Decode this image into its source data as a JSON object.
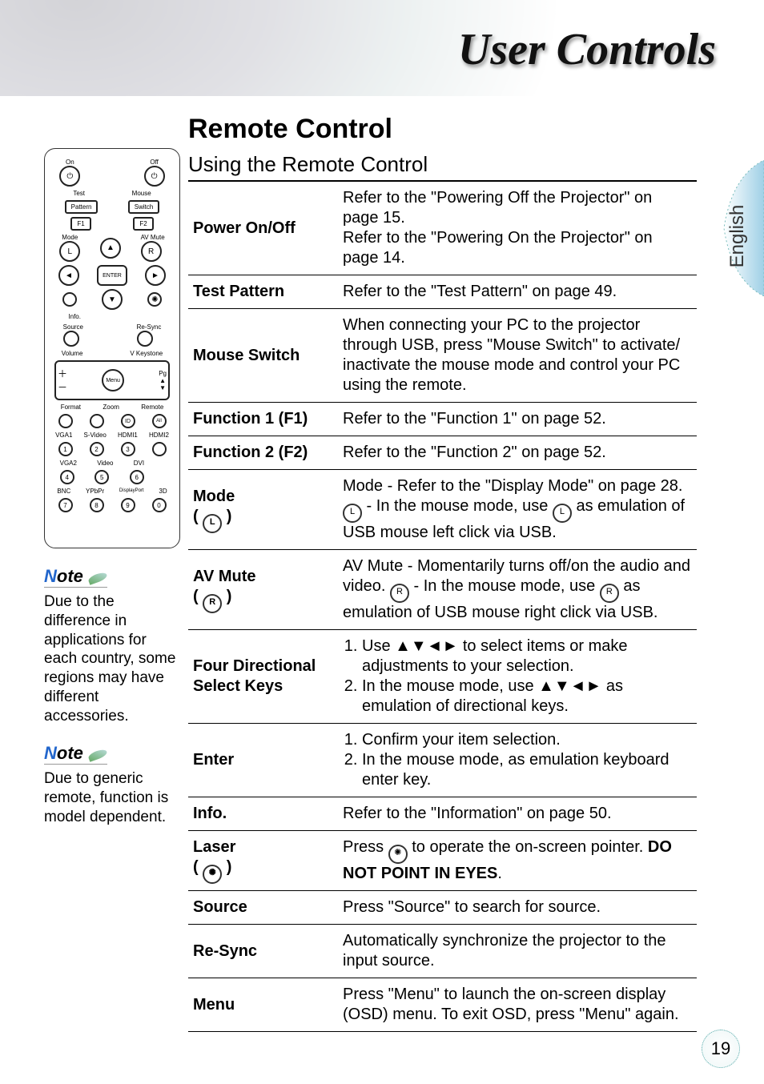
{
  "chapter_title": "User Controls",
  "section_title": "Remote Control",
  "language_tab": "English",
  "page_number": "19",
  "sidebar": {
    "note_label": "ote",
    "note1": "Due to the difference in applications for each country, some regions may have different accessories.",
    "note2": "Due to generic remote,  function is model dependent.",
    "remote_labels": {
      "on": "On",
      "off": "Off",
      "test": "Test",
      "mouse": "Mouse",
      "pattern": "Pattern",
      "switch": "Switch",
      "f1": "F1",
      "f2": "F2",
      "mode": "Mode",
      "avmute": "AV Mute",
      "enter": "ENTER",
      "info": "Info.",
      "resync": "Re-Sync",
      "source": "Source",
      "volume": "Volume",
      "vkey": "V Keystone",
      "menu": "Menu",
      "pg": "Pg",
      "format": "Format",
      "zoom": "Zoom",
      "remote": "Remote",
      "vga1": "VGA1",
      "svideo": "S-Video",
      "hdmi1": "HDMI1",
      "hdmi2": "HDMI2",
      "vga2": "VGA2",
      "video": "Video",
      "dvi": "DVI",
      "bnc": "BNC",
      "ypbpr": "YPbPr",
      "dp": "DisplayPort",
      "threeD": "3D"
    }
  },
  "table": {
    "heading": "Using the Remote Control",
    "rows": [
      {
        "key": "Power On/Off",
        "type": "text",
        "text": "Refer to the \"Powering Off the Projector\" on page 15.\nRefer to the \"Powering On the Projector\" on page 14."
      },
      {
        "key": "Test Pattern",
        "type": "text",
        "text": "Refer to the \"Test Pattern\" on page 49."
      },
      {
        "key": "Mouse Switch",
        "type": "text",
        "text": "When connecting your PC to the projector through USB, press \"Mouse Switch\" to activate/ inactivate the mouse mode and control your PC using the remote."
      },
      {
        "key": "Function 1 (F1)",
        "type": "text",
        "text": "Refer to the \"Function 1\" on page 52."
      },
      {
        "key": "Function 2 (F2)",
        "type": "text",
        "text": "Refer to the \"Function 2\" on page 52."
      },
      {
        "key": "Mode",
        "key_icon": "L",
        "type": "mode",
        "parts": {
          "a": "Mode - Refer to the \"Display Mode\" on page 28.  ",
          "b": " - In the mouse mode, use ",
          "c": " as emulation of USB mouse left click via USB."
        }
      },
      {
        "key": "AV Mute",
        "key_icon": "R",
        "type": "avmute",
        "parts": {
          "a": "AV Mute - Momentarily turns off/on the audio and video.  ",
          "b": " - In the mouse mode, use ",
          "c": " as emulation of USB mouse right click via USB."
        }
      },
      {
        "key": "Four Directional Select Keys",
        "type": "fourdir",
        "parts": {
          "a": "Use ",
          "b": " to select items or make adjustments to your selection.",
          "c": "In the mouse mode, use ",
          "d": " as emulation of directional keys."
        }
      },
      {
        "key": "Enter",
        "type": "enter",
        "parts": {
          "a": "Confirm your item selection.",
          "b": "In the mouse mode, as emulation keyboard enter key."
        }
      },
      {
        "key": "Info.",
        "type": "text",
        "text": "Refer to the \"Information\" on page 50."
      },
      {
        "key": "Laser",
        "key_icon": "*",
        "type": "laser",
        "parts": {
          "a": "Press ",
          "b": " to operate the on-screen pointer. ",
          "bold": "DO NOT POINT IN EYES",
          "c": "."
        }
      },
      {
        "key": "Source",
        "type": "text",
        "text": "Press \"Source\" to search for source."
      },
      {
        "key": "Re-Sync",
        "type": "text",
        "text": "Automatically synchronize the projector to the input source."
      },
      {
        "key": "Menu",
        "type": "text",
        "text": "Press \"Menu\" to launch the on-screen display (OSD) menu. To exit OSD, press \"Menu\" again."
      }
    ],
    "arrows": "▲▼◄►"
  }
}
